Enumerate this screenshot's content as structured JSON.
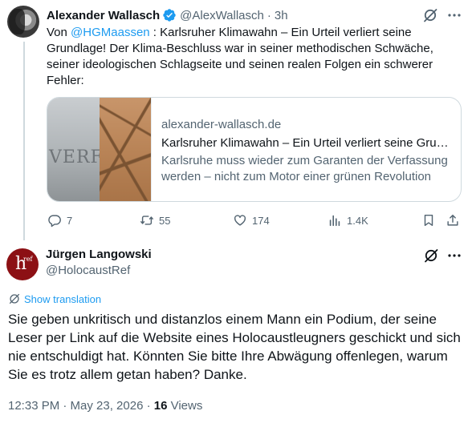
{
  "parent": {
    "name": "Alexander Wallasch",
    "handle": "@AlexWallasch",
    "separator": "·",
    "time": "3h",
    "text_prefix": "Von ",
    "mention": "@HGMaassen",
    "text_body": " : Karlsruher Klimawahn – Ein Urteil verliert seine Grundlage! Der Klima-Beschluss war in seiner methodischen Schwäche, seiner ideologischen Schlagseite und seinen realen Folgen ein schwerer Fehler:",
    "card": {
      "image_text": "VERFAS",
      "domain": "alexander-wallasch.de",
      "title": "Karlsruher Klimawahn – Ein Urteil verliert seine Grundlage!",
      "description": "Karlsruhe muss wieder zum Garanten der Verfassung werden – nicht zum Motor einer grünen Revolution"
    },
    "stats": {
      "replies": "7",
      "reposts": "55",
      "likes": "174",
      "views": "1.4K"
    }
  },
  "reply": {
    "avatar_letter": "h",
    "avatar_sup": "ref",
    "name": "Jürgen Langowski",
    "handle": "@HolocaustRef",
    "show_translation": "Show translation",
    "text": "Sie geben unkritisch und distanzlos einem Mann ein Podium, der seine Leser per Link auf die Website eines Holocaustleugners geschickt und sich nie entschuldigt hat. Könnten Sie bitte Ihre Abwägung offenlegen, warum Sie es trotz allem getan haben? Danke.",
    "timestamp": "12:33 PM · May 23, 2026 · ",
    "views_count": "16",
    "views_label": " Views"
  },
  "colors": {
    "accent": "#1d9bf0",
    "text": "#0f1419",
    "secondary": "#536471",
    "border": "#cfd9de"
  },
  "icons": [
    "verified-badge-icon",
    "grok-icon",
    "more-icon",
    "reply-icon",
    "repost-icon",
    "like-icon",
    "views-icon",
    "bookmark-icon",
    "share-icon",
    "translate-icon"
  ]
}
